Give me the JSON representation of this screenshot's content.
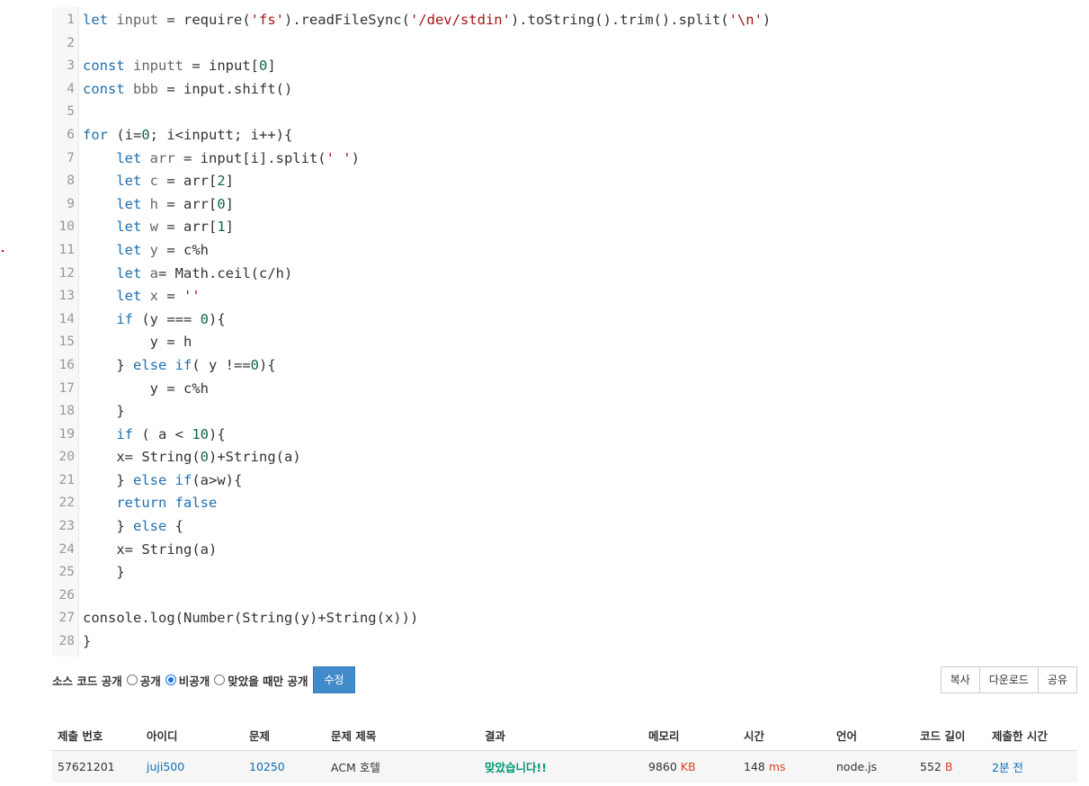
{
  "code": {
    "line_numbers": [
      "1",
      "2",
      "3",
      "4",
      "5",
      "6",
      "7",
      "8",
      "9",
      "10",
      "11",
      "12",
      "13",
      "14",
      "15",
      "16",
      "17",
      "18",
      "19",
      "20",
      "21",
      "22",
      "23",
      "24",
      "25",
      "26",
      "27",
      "28"
    ],
    "lines": [
      [
        {
          "t": "let ",
          "c": "kw"
        },
        {
          "t": "input",
          "c": "var"
        },
        {
          "t": " = require("
        },
        {
          "t": "'fs'",
          "c": "str"
        },
        {
          "t": ").readFileSync("
        },
        {
          "t": "'/dev/stdin'",
          "c": "str"
        },
        {
          "t": ").toString().trim().split("
        },
        {
          "t": "'\\n'",
          "c": "str"
        },
        {
          "t": ")"
        }
      ],
      [],
      [
        {
          "t": "const ",
          "c": "kw"
        },
        {
          "t": "inputt",
          "c": "var"
        },
        {
          "t": " = input["
        },
        {
          "t": "0",
          "c": "num"
        },
        {
          "t": "]"
        }
      ],
      [
        {
          "t": "const ",
          "c": "kw"
        },
        {
          "t": "bbb",
          "c": "var"
        },
        {
          "t": " = input.shift()"
        }
      ],
      [],
      [
        {
          "t": "for ",
          "c": "kw"
        },
        {
          "t": "(i="
        },
        {
          "t": "0",
          "c": "num"
        },
        {
          "t": "; i<inputt; i++){"
        }
      ],
      [
        {
          "t": "    "
        },
        {
          "t": "let ",
          "c": "kw"
        },
        {
          "t": "arr",
          "c": "var"
        },
        {
          "t": " = input[i].split("
        },
        {
          "t": "' '",
          "c": "str"
        },
        {
          "t": ")"
        }
      ],
      [
        {
          "t": "    "
        },
        {
          "t": "let ",
          "c": "kw"
        },
        {
          "t": "c",
          "c": "var"
        },
        {
          "t": " = arr["
        },
        {
          "t": "2",
          "c": "num"
        },
        {
          "t": "]"
        }
      ],
      [
        {
          "t": "    "
        },
        {
          "t": "let ",
          "c": "kw"
        },
        {
          "t": "h",
          "c": "var"
        },
        {
          "t": " = arr["
        },
        {
          "t": "0",
          "c": "num"
        },
        {
          "t": "]"
        }
      ],
      [
        {
          "t": "    "
        },
        {
          "t": "let ",
          "c": "kw"
        },
        {
          "t": "w",
          "c": "var"
        },
        {
          "t": " = arr["
        },
        {
          "t": "1",
          "c": "num"
        },
        {
          "t": "]"
        }
      ],
      [
        {
          "t": "    "
        },
        {
          "t": "let ",
          "c": "kw"
        },
        {
          "t": "y",
          "c": "var"
        },
        {
          "t": " = c%h"
        }
      ],
      [
        {
          "t": "    "
        },
        {
          "t": "let ",
          "c": "kw"
        },
        {
          "t": "a",
          "c": "var"
        },
        {
          "t": "= Math.ceil(c/h)"
        }
      ],
      [
        {
          "t": "    "
        },
        {
          "t": "let ",
          "c": "kw"
        },
        {
          "t": "x",
          "c": "var"
        },
        {
          "t": " = "
        },
        {
          "t": "''",
          "c": "str"
        }
      ],
      [
        {
          "t": "    "
        },
        {
          "t": "if ",
          "c": "kw"
        },
        {
          "t": "(y === "
        },
        {
          "t": "0",
          "c": "num"
        },
        {
          "t": "){"
        }
      ],
      [
        {
          "t": "        y = h"
        }
      ],
      [
        {
          "t": "    } "
        },
        {
          "t": "else if",
          "c": "kw"
        },
        {
          "t": "( y !=="
        },
        {
          "t": "0",
          "c": "num"
        },
        {
          "t": "){"
        }
      ],
      [
        {
          "t": "        y = c%h"
        }
      ],
      [
        {
          "t": "    }"
        }
      ],
      [
        {
          "t": "    "
        },
        {
          "t": "if ",
          "c": "kw"
        },
        {
          "t": "( a < "
        },
        {
          "t": "10",
          "c": "num"
        },
        {
          "t": "){"
        }
      ],
      [
        {
          "t": "    x= String("
        },
        {
          "t": "0",
          "c": "num"
        },
        {
          "t": ")+String(a)"
        }
      ],
      [
        {
          "t": "    } "
        },
        {
          "t": "else if",
          "c": "kw"
        },
        {
          "t": "(a>w){"
        }
      ],
      [
        {
          "t": "    "
        },
        {
          "t": "return false",
          "c": "kw"
        }
      ],
      [
        {
          "t": "    } "
        },
        {
          "t": "else ",
          "c": "kw"
        },
        {
          "t": "{"
        }
      ],
      [
        {
          "t": "    x= String(a)"
        }
      ],
      [
        {
          "t": "    }"
        }
      ],
      [],
      [
        {
          "t": "console.log(Number(String(y)+String(x)))"
        }
      ],
      [
        {
          "t": "}"
        }
      ]
    ]
  },
  "visibility": {
    "label": "소스 코드 공개",
    "options": [
      {
        "label": "공개",
        "checked": false
      },
      {
        "label": "비공개",
        "checked": true
      },
      {
        "label": "맞았을 때만 공개",
        "checked": false
      }
    ],
    "edit_label": "수정"
  },
  "actions": {
    "copy": "복사",
    "download": "다운로드",
    "share": "공유"
  },
  "table": {
    "headers": [
      "제출 번호",
      "아이디",
      "문제",
      "문제 제목",
      "결과",
      "메모리",
      "시간",
      "언어",
      "코드 길이",
      "제출한 시간"
    ],
    "row": {
      "submission_id": "57621201",
      "user_id": "juji500",
      "problem": "10250",
      "problem_title": "ACM 호텔",
      "result": "맞았습니다!!",
      "memory": "9860",
      "memory_unit": "KB",
      "time": "148",
      "time_unit": "ms",
      "language": "node.js",
      "code_length": "552",
      "code_length_unit": "B",
      "submitted": "2분 전"
    }
  },
  "colors": {
    "keyword": "#1f6faf",
    "number": "#116644",
    "string": "#a31515",
    "accepted": "#009874",
    "unit": "#dd4124",
    "link": "#0e6eb8",
    "edit_button": "#428bca"
  }
}
